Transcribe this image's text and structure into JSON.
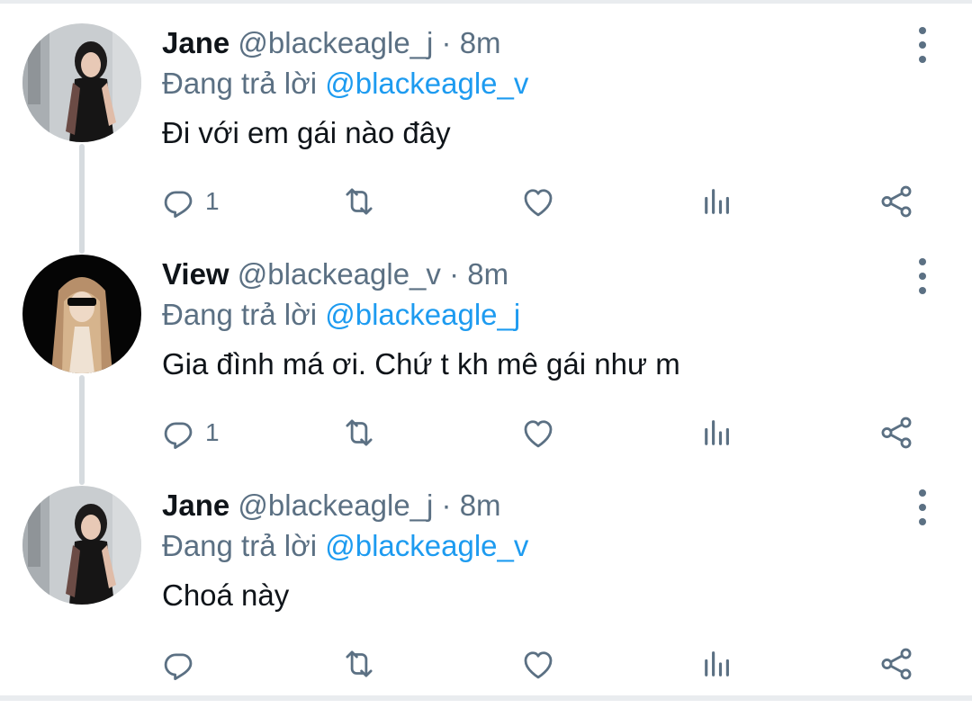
{
  "tweets": [
    {
      "avatar": "woman-portrait-grey-background",
      "name": "Jane",
      "handle": "@blackeagle_j",
      "separator": "·",
      "time": "8m",
      "replying_prefix": "Đang trả lời",
      "replying_to": "@blackeagle_v",
      "text": "Đi với em gái nào đây",
      "reply_count": "1",
      "retweet_count": "",
      "like_count": ""
    },
    {
      "avatar": "woman-sunglasses-dark-background",
      "name": "View",
      "handle": "@blackeagle_v",
      "separator": "·",
      "time": "8m",
      "replying_prefix": "Đang trả lời",
      "replying_to": "@blackeagle_j",
      "text": "Gia đình má ơi. Chứ t kh mê gái như m",
      "reply_count": "1",
      "retweet_count": "",
      "like_count": ""
    },
    {
      "avatar": "woman-portrait-grey-background",
      "name": "Jane",
      "handle": "@blackeagle_j",
      "separator": "·",
      "time": "8m",
      "replying_prefix": "Đang trả lời",
      "replying_to": "@blackeagle_v",
      "text": "Choá này",
      "reply_count": "",
      "retweet_count": "",
      "like_count": ""
    }
  ],
  "icons": {
    "reply": "reply-icon",
    "retweet": "retweet-icon",
    "like": "heart-icon",
    "stats": "analytics-icon",
    "share": "share-icon",
    "more": "more-vertical-icon"
  },
  "colors": {
    "text": "#0f1419",
    "secondary": "#5b7083",
    "link": "#1d9bf0",
    "thread_line": "#d6dbdf",
    "divider": "#e9ecef"
  }
}
